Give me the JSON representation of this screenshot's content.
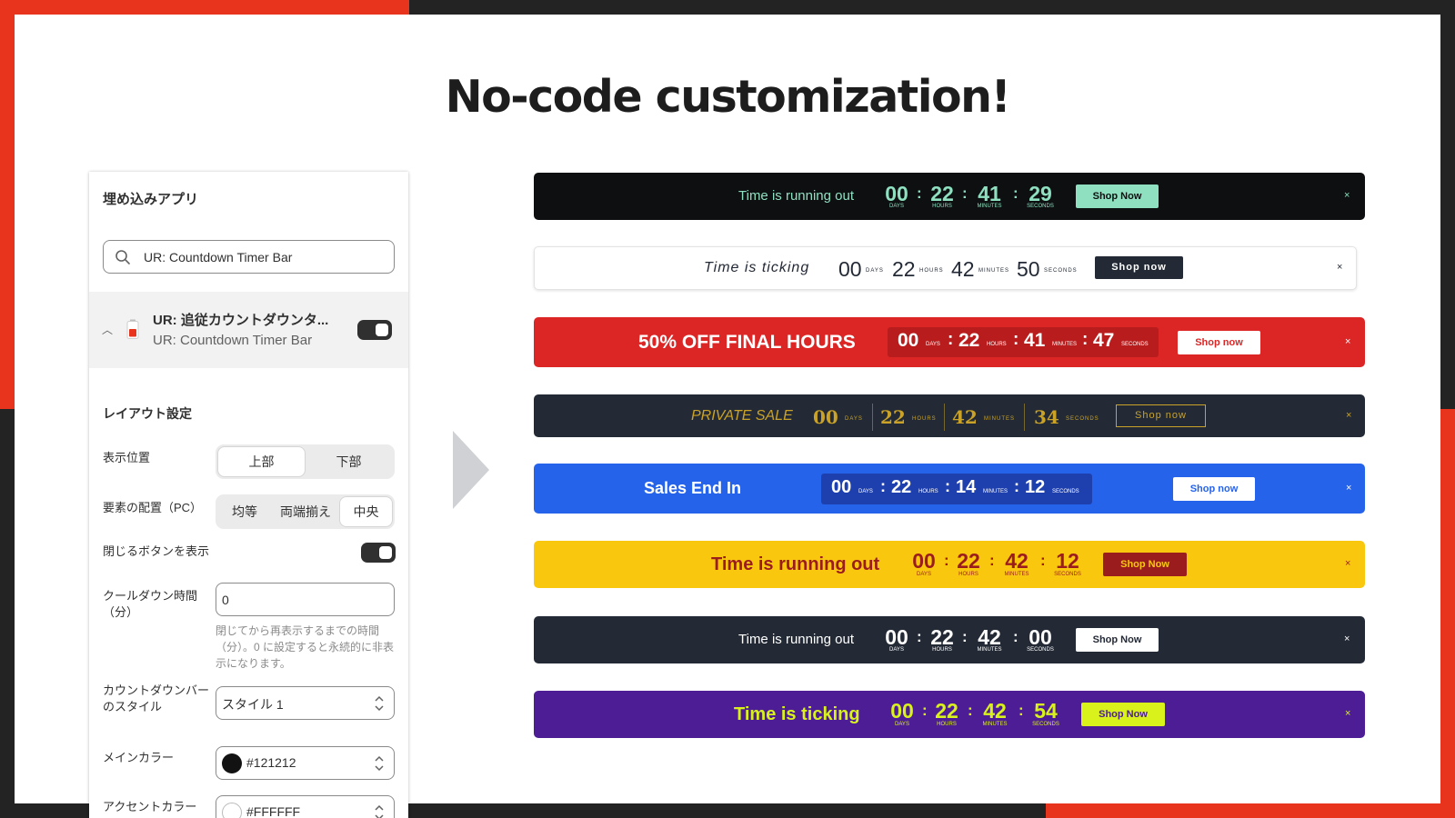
{
  "headline": "No-code customization!",
  "panel": {
    "title": "埋め込みアプリ",
    "search_value": "UR: Countdown Timer Bar",
    "app": {
      "name": "UR: 追従カウントダウンタ...",
      "subtitle": "UR: Countdown Timer Bar",
      "enabled": true
    },
    "layout_heading": "レイアウト設定",
    "position": {
      "label": "表示位置",
      "options": [
        "上部",
        "下部"
      ],
      "selected": "上部"
    },
    "alignment": {
      "label": "要素の配置（PC）",
      "options": [
        "均等",
        "両端揃え",
        "中央"
      ],
      "selected": "中央"
    },
    "close_button": {
      "label": "閉じるボタンを表示",
      "enabled": true
    },
    "cooldown": {
      "label": "クールダウン時間（分）",
      "value": "0",
      "help": "閉じてから再表示するまでの時間（分）。0 に設定すると永続的に非表示になります。"
    },
    "bar_style": {
      "label": "カウントダウンバーのスタイル",
      "value": "スタイル 1"
    },
    "main_color": {
      "label": "メインカラー",
      "value": "#121212",
      "swatch": "#121212"
    },
    "accent_color": {
      "label": "アクセントカラー",
      "value": "#FFFFFF",
      "swatch": "#FFFFFF"
    }
  },
  "bars": [
    {
      "message": "Time is running out",
      "days": "00",
      "hours": "22",
      "minutes": "41",
      "seconds": "29",
      "units": [
        "DAYS",
        "HOURS",
        "MINUTES",
        "SECONDS"
      ],
      "button": "Shop Now",
      "close": "×",
      "colors": {
        "bg": "#0d0f10",
        "text": "#8ee0c1",
        "button_bg": "#8ee0c1",
        "button_text": "#0d0f10"
      }
    },
    {
      "message": "Time is ticking",
      "days": "00",
      "hours": "22",
      "minutes": "42",
      "seconds": "50",
      "units": [
        "DAYS",
        "HOURS",
        "MINUTES",
        "SECONDS"
      ],
      "button": "Shop now",
      "close": "×",
      "colors": {
        "bg": "#ffffff",
        "text": "#232a36",
        "button_bg": "#232a36",
        "button_text": "#ffffff"
      }
    },
    {
      "message": "50% OFF FINAL HOURS",
      "days": "00",
      "hours": "22",
      "minutes": "41",
      "seconds": "47",
      "units": [
        "DAYS",
        "HOURS",
        "MINUTES",
        "SECONDS"
      ],
      "button": "Shop now",
      "close": "×",
      "colors": {
        "bg": "#dc2626",
        "text": "#ffffff",
        "button_bg": "#ffffff",
        "button_text": "#dc2626"
      }
    },
    {
      "message": "PRIVATE SALE",
      "days": "00",
      "hours": "22",
      "minutes": "42",
      "seconds": "34",
      "units": [
        "DAYS",
        "HOURS",
        "MINUTES",
        "SECONDS"
      ],
      "button": "Shop now",
      "close": "×",
      "colors": {
        "bg": "#232a36",
        "text": "#c9a227",
        "button_bg": "transparent",
        "button_text": "#c9a227"
      }
    },
    {
      "message": "Sales End In",
      "days": "00",
      "hours": "22",
      "minutes": "14",
      "seconds": "12",
      "units": [
        "DAYS",
        "HOURS",
        "MINUTES",
        "SECONDS"
      ],
      "button": "Shop now",
      "close": "×",
      "colors": {
        "bg": "#2563eb",
        "text": "#ffffff",
        "button_bg": "#ffffff",
        "button_text": "#2563eb"
      }
    },
    {
      "message": "Time is running out",
      "days": "00",
      "hours": "22",
      "minutes": "42",
      "seconds": "12",
      "units": [
        "DAYS",
        "HOURS",
        "MINUTES",
        "SECONDS"
      ],
      "button": "Shop Now",
      "close": "×",
      "colors": {
        "bg": "#f9c80e",
        "text": "#9b1c1c",
        "button_bg": "#9b1c1c",
        "button_text": "#f9c80e"
      }
    },
    {
      "message": "Time is running out",
      "days": "00",
      "hours": "22",
      "minutes": "42",
      "seconds": "00",
      "units": [
        "DAYS",
        "HOURS",
        "MINUTES",
        "SECONDS"
      ],
      "button": "Shop Now",
      "close": "×",
      "colors": {
        "bg": "#232a36",
        "text": "#ffffff",
        "button_bg": "#ffffff",
        "button_text": "#232a36"
      }
    },
    {
      "message": "Time is ticking",
      "days": "00",
      "hours": "22",
      "minutes": "42",
      "seconds": "54",
      "units": [
        "DAYS",
        "HOURS",
        "MINUTES",
        "SECONDS"
      ],
      "button": "Shop Now",
      "close": "×",
      "colors": {
        "bg": "#4c1d95",
        "text": "#d9f21c",
        "button_bg": "#d9f21c",
        "button_text": "#4c1d95"
      }
    }
  ]
}
